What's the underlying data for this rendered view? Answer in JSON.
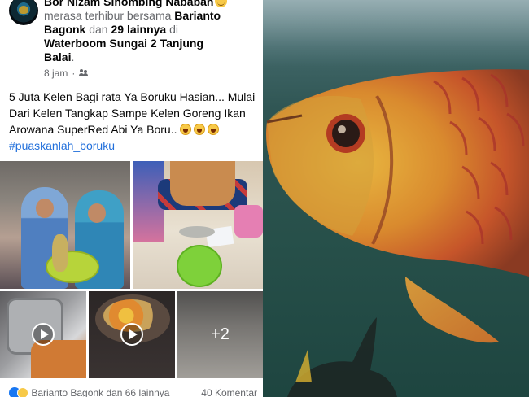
{
  "post": {
    "author": "Bor Nizam Sihombing Nababan",
    "feeling_prefix": "merasa terhibur bersama ",
    "tagged_name": "Barianto Bagonk",
    "and_text": " dan ",
    "others": "29 lainnya",
    "at_text": " di ",
    "location": "Waterboom Sungai 2 Tanjung Balai",
    "time": "8 jam",
    "privacy_icon": "friends-icon",
    "text": "5 Juta Kelen Bagi rata Ya Boruku Hasian... Mulai Dari Kelen Tangkap Sampe Kelen Goreng Ikan Arowana SuperRed Abi Ya Boru..",
    "hashtag": "#puaskanlah_boruku",
    "extra_photos": "+2",
    "reactions_text": "Barianto Bagonk dan 66 lainnya",
    "comments_text": "40 Komentar"
  },
  "colors": {
    "link_blue": "#216fdb",
    "muted_gray": "#65676b",
    "water_green": "#2f5553",
    "fish_red": "#c7462b"
  }
}
